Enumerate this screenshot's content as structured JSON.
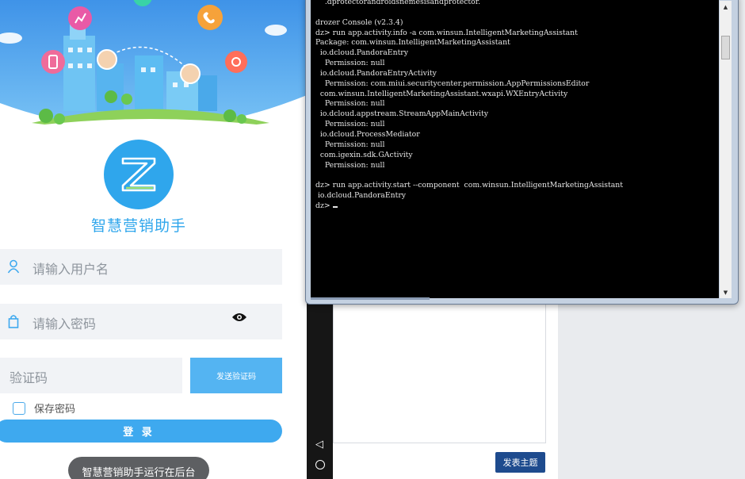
{
  "login_app": {
    "app_name": "智慧营销助手",
    "username_placeholder": "请输入用户名",
    "password_placeholder": "请输入密码",
    "code_placeholder": "验证码",
    "send_code_label": "发送验证码",
    "remember_label": "保存密码",
    "login_label": "登 录",
    "toast": "智慧营销助手运行在后台"
  },
  "webpage": {
    "publish_label": "发表主题"
  },
  "console": {
    "lines": [
      "    .dprotectorandroidsnemesisandprotector.",
      "",
      "drozer Console (v2.3.4)",
      "dz> run app.activity.info -a com.winsun.IntelligentMarketingAssistant",
      "Package: com.winsun.IntelligentMarketingAssistant",
      "  io.dcloud.PandoraEntry",
      "    Permission: null",
      "  io.dcloud.PandoraEntryActivity",
      "    Permission: com.miui.securitycenter.permission.AppPermissionsEditor",
      "  com.winsun.IntelligentMarketingAssistant.wxapi.WXEntryActivity",
      "    Permission: null",
      "  io.dcloud.appstream.StreamAppMainActivity",
      "    Permission: null",
      "  io.dcloud.ProcessMediator",
      "    Permission: null",
      "  com.igexin.sdk.GActivity",
      "    Permission: null",
      "",
      "dz> run app.activity.start --component  com.winsun.IntelligentMarketingAssistant",
      " io.dcloud.PandoraEntry",
      "dz> "
    ]
  },
  "colors": {
    "accent": "#2fa6ec",
    "button": "#3ea9ef",
    "console_bg": "#000000",
    "publish": "#1e4b8e"
  }
}
